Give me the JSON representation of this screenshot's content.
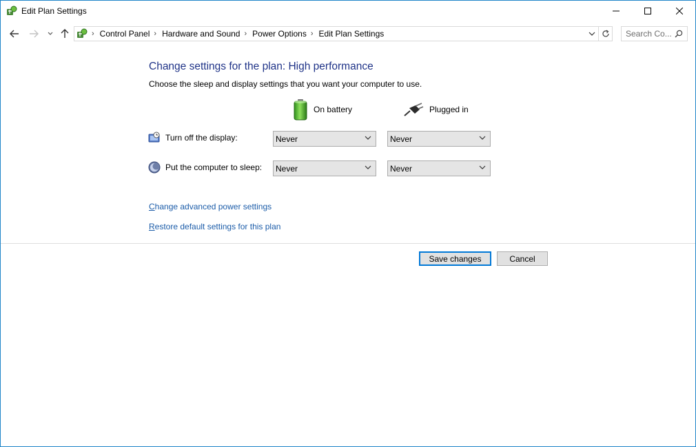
{
  "window": {
    "title": "Edit Plan Settings",
    "accent_color": "#1e84c9"
  },
  "caption_buttons": [
    "minimize-icon",
    "maximize-icon",
    "close-icon"
  ],
  "nav": {
    "breadcrumbs": [
      "Control Panel",
      "Hardware and Sound",
      "Power Options",
      "Edit Plan Settings"
    ],
    "separator": "›",
    "search_placeholder": "Search Co..."
  },
  "main": {
    "heading": "Change settings for the plan: High performance",
    "subheading": "Choose the sleep and display settings that you want your computer to use.",
    "columns": {
      "battery": "On battery",
      "plugged": "Plugged in"
    },
    "rows": {
      "display": {
        "label": "Turn off the display:",
        "battery_value": "Never",
        "plugged_value": "Never"
      },
      "sleep": {
        "label": "Put the computer to sleep:",
        "battery_value": "Never",
        "plugged_value": "Never"
      }
    },
    "links": {
      "advanced_first": "C",
      "advanced_rest": "hange advanced power settings",
      "restore_first": "R",
      "restore_rest": "estore default settings for this plan"
    }
  },
  "footer": {
    "save_label": "Save changes",
    "cancel_label": "Cancel"
  },
  "colors": {
    "heading": "#1e3287",
    "link": "#1a5ba8",
    "primary_button_border": "#0078d7"
  }
}
